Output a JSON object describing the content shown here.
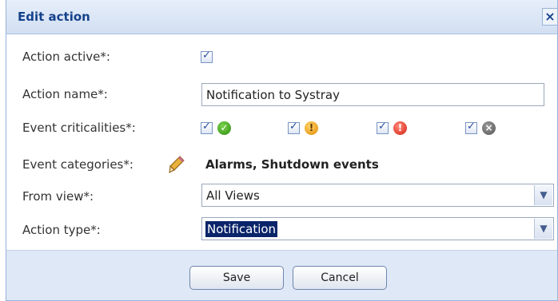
{
  "dialog": {
    "title": "Edit action",
    "close_label": "×"
  },
  "fields": {
    "action_active": {
      "label": "Action active*:",
      "checked": true
    },
    "action_name": {
      "label": "Action name*:",
      "value": "Notification to Systray"
    },
    "event_criticalities": {
      "label": "Event criticalities*:",
      "items": [
        {
          "icon": "success-icon",
          "checked": true
        },
        {
          "icon": "warning-icon",
          "checked": true
        },
        {
          "icon": "error-icon",
          "checked": true
        },
        {
          "icon": "critical-x-icon",
          "checked": true
        }
      ]
    },
    "event_categories": {
      "label": "Event categories*:",
      "value": "Alarms, Shutdown events",
      "edit_icon": "pencil-icon"
    },
    "from_view": {
      "label": "From view*:",
      "value": "All Views"
    },
    "action_type": {
      "label": "Action type*:",
      "value": "Notification"
    }
  },
  "buttons": {
    "save": "Save",
    "cancel": "Cancel"
  },
  "colors": {
    "title_text": "#15428b",
    "footer_bg": "#dfe8f6",
    "selection_bg": "#0a246a"
  }
}
